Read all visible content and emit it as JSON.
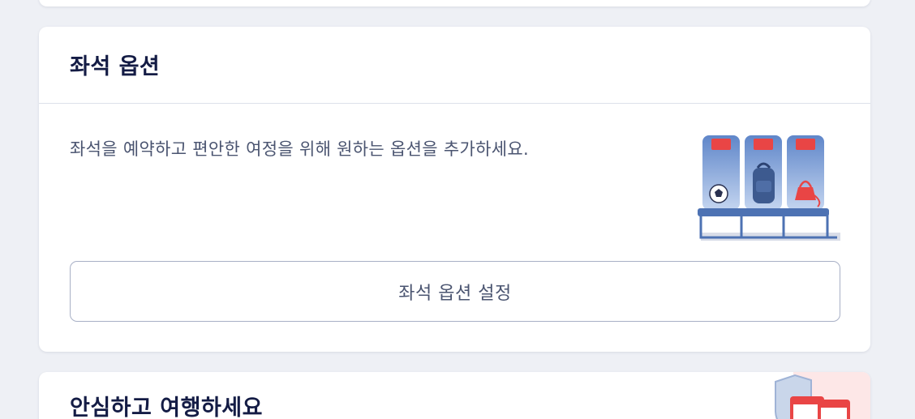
{
  "seat_options": {
    "title": "좌석 옵션",
    "description": "좌석을 예약하고 편안한 여정을 위해 원하는 옵션을 추가하세요.",
    "button_label": "좌석 옵션 설정"
  },
  "travel_safe": {
    "title": "안심하고 여행하세요"
  },
  "colors": {
    "page_background": "#eef0f5",
    "card_background": "#ffffff",
    "title_text": "#141c45",
    "body_text": "#4a5470",
    "seat_blue": "#6f93cf",
    "headrest_red": "#e94545"
  }
}
